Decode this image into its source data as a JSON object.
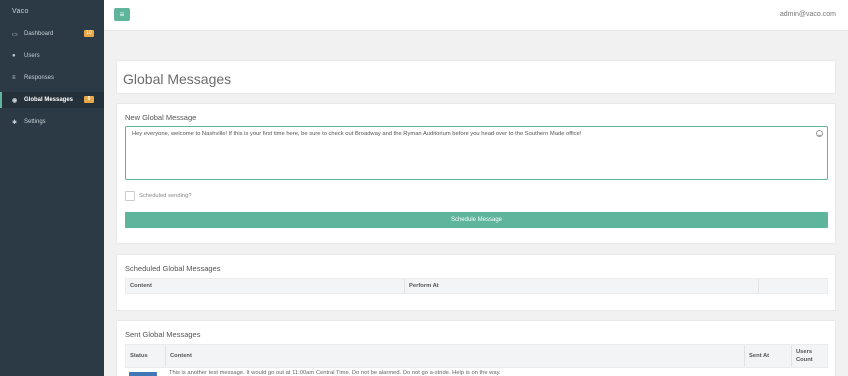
{
  "sidebar": {
    "brand": "Vaco",
    "items": [
      {
        "label": "Dashboard",
        "icon": "monitor-icon",
        "glyph": "▭",
        "badge": "10"
      },
      {
        "label": "Users",
        "icon": "user-icon",
        "glyph": "●",
        "badge": ""
      },
      {
        "label": "Responses",
        "icon": "list-icon",
        "glyph": "≡",
        "badge": ""
      },
      {
        "label": "Global Messages",
        "icon": "globe-icon",
        "glyph": "◉",
        "badge": "0"
      },
      {
        "label": "Settings",
        "icon": "gear-icon",
        "glyph": "✱",
        "badge": ""
      }
    ],
    "active_index": 3
  },
  "topbar": {
    "menu_icon": "hamburger-menu-icon",
    "menu_glyph": "≡",
    "user": "admin@vaco.com"
  },
  "page": {
    "title": "Global Messages"
  },
  "new_message": {
    "title": "New Global Message",
    "text": "Hey everyone, welcome to Nashville! If this is your first time here, be sure to check out Broadway and the Ryman Auditorium before you head over to the Southern Made office!",
    "scheduled_label": "Scheduled sending?",
    "submit_label": "Schedule Message"
  },
  "scheduled": {
    "title": "Scheduled Global Messages",
    "columns": [
      "Content",
      "Perform At",
      ""
    ]
  },
  "sent": {
    "title": "Sent Global Messages",
    "columns": [
      "Status",
      "Content",
      "Sent At",
      "Users Count"
    ],
    "first_row_peek": "This is another test message. It would go out at 11:00am Central Time. Do not be alarmed. Do not go a-stride. Help is on the way."
  },
  "colors": {
    "accent": "#5fb49c",
    "sidebar": "#2b3a45",
    "badge": "#e8a849"
  }
}
